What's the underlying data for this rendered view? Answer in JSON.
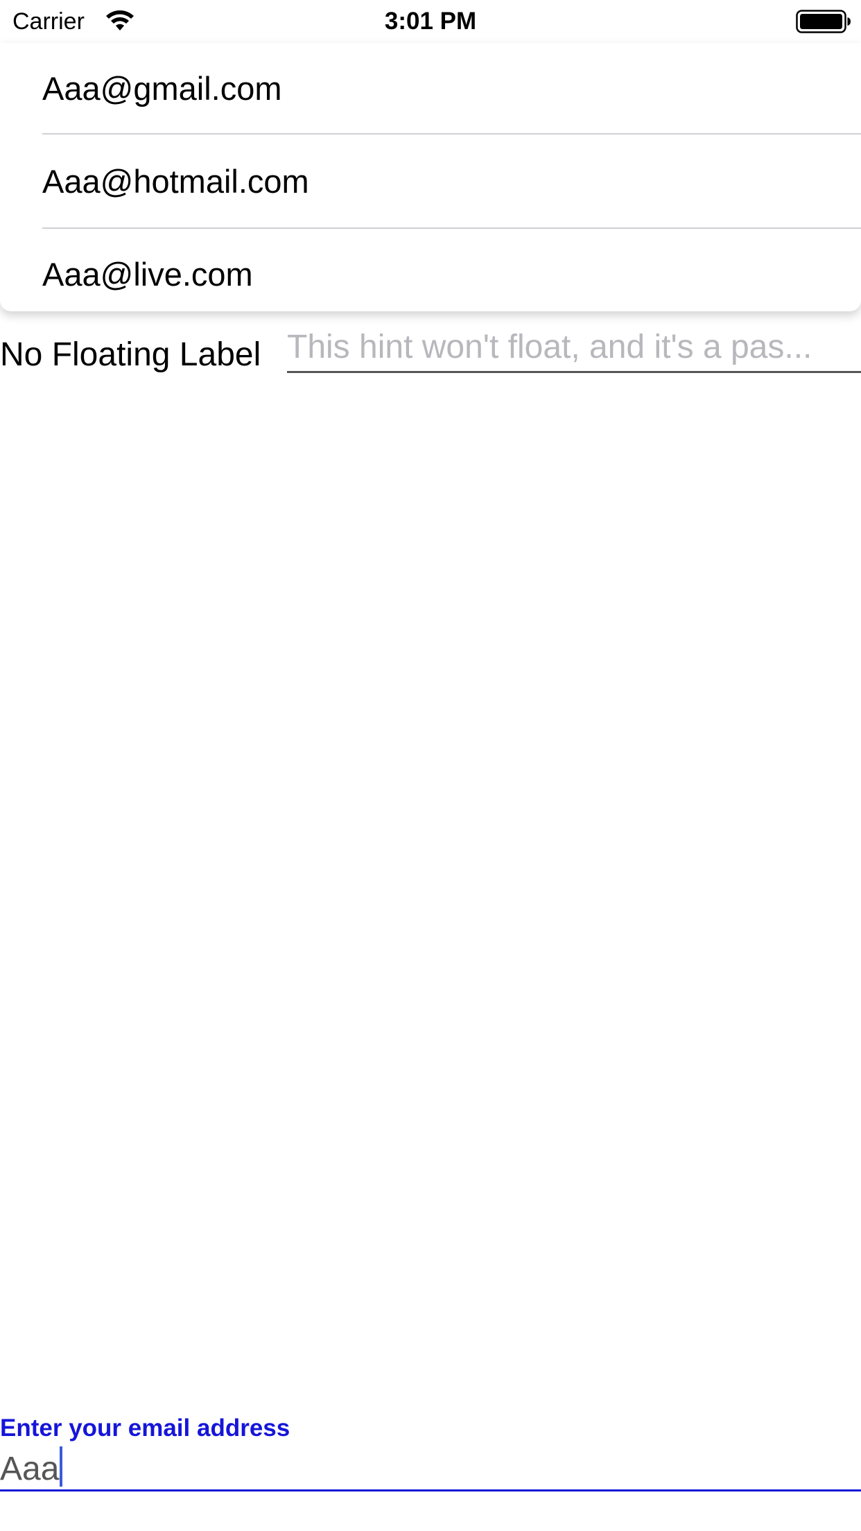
{
  "status_bar": {
    "carrier": "Carrier",
    "time": "3:01 PM",
    "wifi_icon": "wifi-icon",
    "battery_icon": "battery-icon"
  },
  "suggestions": [
    {
      "label": "Aaa@gmail.com"
    },
    {
      "label": "Aaa@hotmail.com"
    },
    {
      "label": "Aaa@live.com"
    }
  ],
  "no_floating": {
    "label": "No Floating Label",
    "placeholder": "This hint won't float, and it's a pas..."
  },
  "email": {
    "label": "Enter your email address",
    "value": "Aaa"
  },
  "colors": {
    "accent": "#1515d9",
    "caret": "#3b5bdb",
    "placeholder": "#b7b7bc",
    "divider": "#d0d0d4"
  }
}
